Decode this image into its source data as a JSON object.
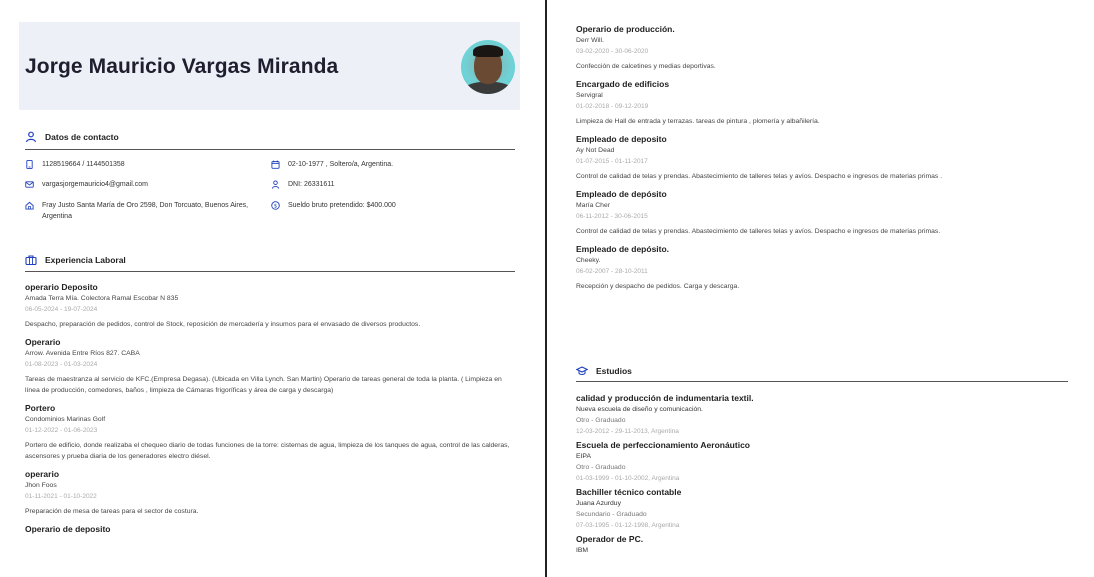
{
  "profile": {
    "name": "Jorge Mauricio Vargas Miranda"
  },
  "contact": {
    "title": "Datos de contacto",
    "phone": "1128519664 / 1144501358",
    "birth": "02-10-1977 , Soltero/a, Argentina.",
    "email": "vargasjorgemauricio4@gmail.com",
    "dni": "DNI: 26331611",
    "address": "Fray Justo Santa María de Oro 2598, Don Torcuato, Buenos Aires, Argentina",
    "salary": "Sueldo bruto pretendido: $400.000"
  },
  "experience": {
    "title": "Experiencia Laboral",
    "left_items": [
      {
        "title": "operario Deposito",
        "company": "Amada Terra Mía. Colectora Ramal Escobar N 835",
        "dates": "06-05-2024 - 19-07-2024",
        "desc": "Despacho, preparación de pedidos, control de Stock, reposición de mercadería y insumos para el envasado de diversos productos."
      },
      {
        "title": "Operario",
        "company": "Arrow. Avenida Entre Ríos 827. CABA",
        "dates": "01-08-2023 - 01-03-2024",
        "desc": "Tareas de maestranza al servicio de KFC.(Empresa Degasa). (Ubicada en Villa Lynch. San Martin) Operario de tareas general de toda la planta. ( Limpieza en línea de producción, comedores, baños , limpieza de Cámaras frigoríficas y área de carga y descarga)"
      },
      {
        "title": "Portero",
        "company": "Condominios Marinas Golf",
        "dates": "01-12-2022 - 01-06-2023",
        "desc": "Portero de edificio, donde realizaba el chequeo diario de todas funciones de la torre: cisternas de agua, limpieza de los tanques de agua, control de las calderas, ascensores y prueba diaria de los generadores electro diésel."
      },
      {
        "title": "operario",
        "company": "Jhon Foos",
        "dates": "01-11-2021 - 01-10-2022",
        "desc": "Preparación de mesa de tareas para el sector de costura."
      },
      {
        "title": "Operario de deposito",
        "company": "",
        "dates": "",
        "desc": ""
      }
    ],
    "right_items": [
      {
        "title": "Operario de producción.",
        "company": "Derr Will.",
        "dates": "03-02-2020 - 30-06-2020",
        "desc": "Confección de calcetines y medias deportivas."
      },
      {
        "title": "Encargado de edificios",
        "company": "Servigral",
        "dates": "01-02-2018 - 09-12-2019",
        "desc": "Limpieza de Hall de entrada y terrazas. tareas de pintura , plomería y albañilería."
      },
      {
        "title": "Empleado de deposito",
        "company": "Ay Not Dead",
        "dates": "01-07-2015 - 01-11-2017",
        "desc": "Control de calidad de telas y prendas. Abastecimiento de talleres telas y avíos. Despacho e ingresos de materias primas ."
      },
      {
        "title": "Empleado de depósito",
        "company": "María Cher",
        "dates": "06-11-2012 - 30-06-2015",
        "desc": "Control de calidad de telas y prendas. Abastecimiento de talleres telas y avíos. Despacho e ingresos de materias primas."
      },
      {
        "title": "Empleado de depósito.",
        "company": "Cheeky.",
        "dates": "06-02-2007 - 28-10-2011",
        "desc": "Recepción y despacho de pedidos. Carga y descarga."
      }
    ]
  },
  "education": {
    "title": "Estudios",
    "items": [
      {
        "title": "calidad y producción de indumentaria textil.",
        "school": "Nueva escuela de diseño y comunicación.",
        "level": "Otro - Graduado",
        "dates": "12-03-2012 - 29-11-2013, Argentina"
      },
      {
        "title": "Escuela de perfeccionamiento Aeronáutico",
        "school": "EIPA",
        "level": "Otro - Graduado",
        "dates": "01-03-1999 - 01-10-2002, Argentina"
      },
      {
        "title": "Bachiller técnico contable",
        "school": "Juana Azurduy",
        "level": "Secundario - Graduado",
        "dates": "07-03-1995 - 01-12-1998, Argentina"
      },
      {
        "title": "Operador de PC.",
        "school": "IBM",
        "level": "",
        "dates": ""
      }
    ]
  },
  "colors": {
    "accent": "#1f3fbf",
    "header_bg": "#eef0f8"
  }
}
